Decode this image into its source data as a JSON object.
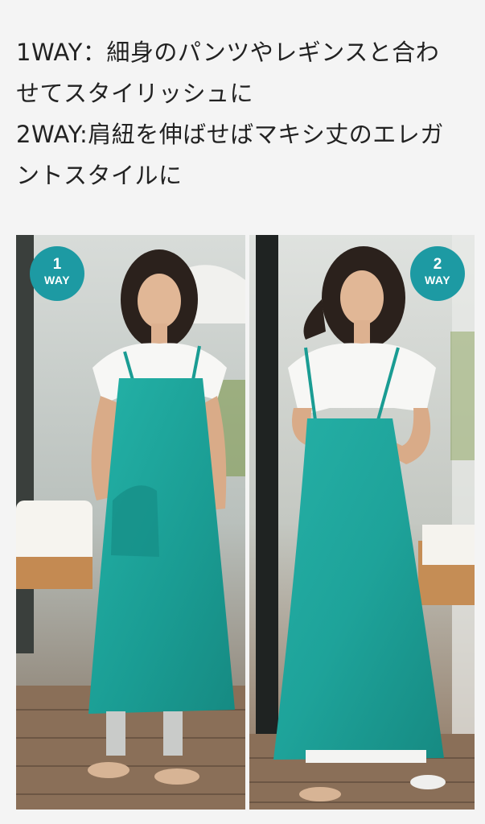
{
  "description": {
    "lines": [
      "1WAY：細身のパンツやレギンスと合わ",
      "せてスタイリッシュに",
      "2WAY:肩紐を伸ばせばマキシ丈のエレガ",
      "ントスタイルに"
    ]
  },
  "photos": [
    {
      "badge_number": "1",
      "badge_label": "WAY"
    },
    {
      "badge_number": "2",
      "badge_label": "WAY"
    }
  ],
  "colors": {
    "background": "#f4f4f4",
    "text": "#222222",
    "badge": "#1d9aa3",
    "dress": "#1ea9a0",
    "deck": "#8a6f58"
  }
}
